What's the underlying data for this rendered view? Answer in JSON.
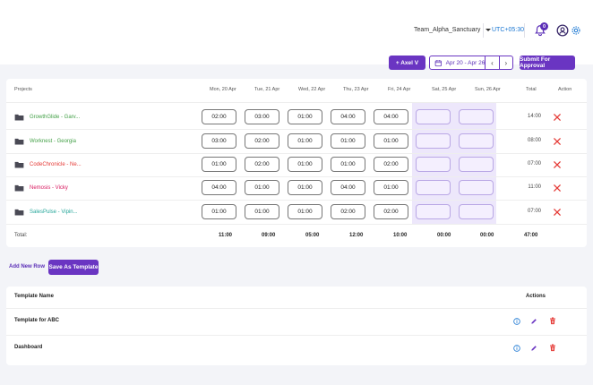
{
  "header": {
    "team": "Team_Alpha_Sanctuary",
    "timezone": "UTC+05:30",
    "notification_count": "0"
  },
  "toolbar": {
    "user_btn": "+  Axel V",
    "date_range": "Apr 20 - Apr 26",
    "prev": "‹",
    "next": "›",
    "submit": "Submit For Approval"
  },
  "timesheet": {
    "columns": [
      "Projects",
      "Mon, 20 Apr",
      "Tue, 21 Apr",
      "Wed, 22 Apr",
      "Thu, 23 Apr",
      "Fri, 24 Apr",
      "Sat, 25 Apr",
      "Sun, 26 Apr",
      "Total",
      "Action"
    ],
    "rows": [
      {
        "project": "GrowthGlide - Garv...",
        "color": "#43a047",
        "hours": [
          "02:00",
          "03:00",
          "01:00",
          "04:00",
          "04:00",
          "",
          ""
        ],
        "total": "14:00"
      },
      {
        "project": "Worknest - Georgia",
        "color": "#43a047",
        "hours": [
          "03:00",
          "02:00",
          "01:00",
          "01:00",
          "01:00",
          "",
          ""
        ],
        "total": "08:00"
      },
      {
        "project": "CodeChronicle - Ne...",
        "color": "#e53935",
        "hours": [
          "01:00",
          "02:00",
          "01:00",
          "01:00",
          "02:00",
          "",
          ""
        ],
        "total": "07:00"
      },
      {
        "project": "Nemosis - Vicky",
        "color": "#d81b60",
        "hours": [
          "04:00",
          "01:00",
          "01:00",
          "04:00",
          "01:00",
          "",
          ""
        ],
        "total": "11:00"
      },
      {
        "project": "SalesPulse - Vipin...",
        "color": "#26a69a",
        "hours": [
          "01:00",
          "01:00",
          "01:00",
          "02:00",
          "02:00",
          "",
          ""
        ],
        "total": "07:00"
      }
    ],
    "totals": {
      "label": "Total:",
      "days": [
        "11:00",
        "09:00",
        "05:00",
        "12:00",
        "10:00",
        "00:00",
        "00:00"
      ],
      "grand": "47:00"
    }
  },
  "actions": {
    "add_row": "Add New Row",
    "save_template": "Save As Template"
  },
  "templates": {
    "header_name": "Template Name",
    "header_actions": "Actions",
    "rows": [
      {
        "name": "Template for ABC"
      },
      {
        "name": "Dashboard"
      }
    ]
  },
  "colors": {
    "accent": "#6a35c2",
    "delete": "#e53935",
    "info": "#1976d2",
    "weekend": "#ede7fb"
  }
}
